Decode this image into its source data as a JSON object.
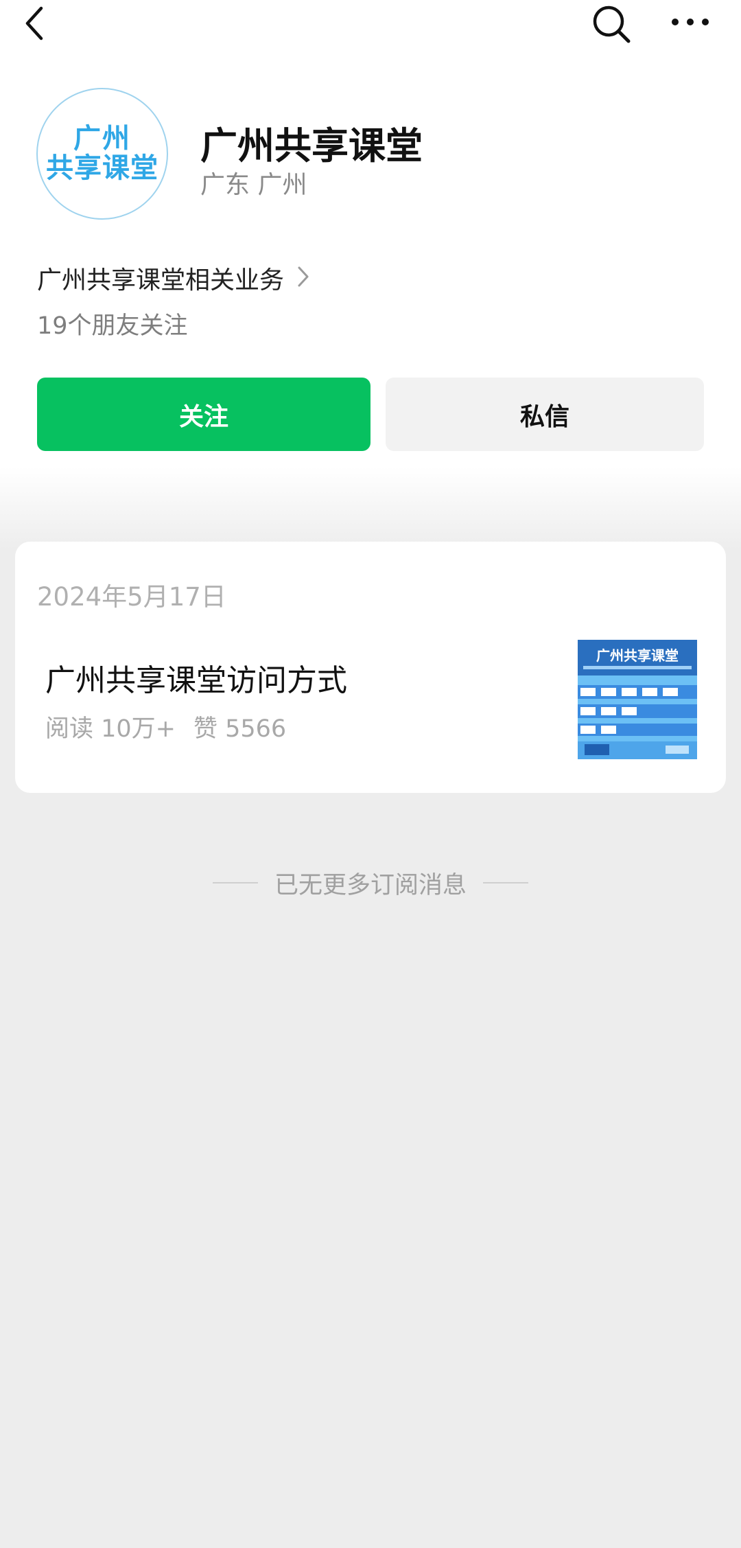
{
  "topbar": {
    "back_icon": "back-chevron-icon",
    "search_icon": "search-icon",
    "more_icon": "more-dots-icon"
  },
  "account": {
    "avatar_line1": "广州",
    "avatar_line2": "共享课堂",
    "name": "广州共享课堂",
    "region": "广东 广州",
    "business": "广州共享课堂相关业务",
    "friends_following": "19个朋友关注"
  },
  "actions": {
    "follow_label": "关注",
    "message_label": "私信"
  },
  "articles": [
    {
      "date": "2024年5月17日",
      "title": "广州共享课堂访问方式",
      "reads": "阅读 10万+",
      "likes": "赞 5566",
      "thumbnail_title": "广州共享课堂"
    }
  ],
  "footer": {
    "end_text": "已无更多订阅消息"
  },
  "colors": {
    "accent_green": "#07c160",
    "avatar_blue": "#2fa7e6",
    "page_bg": "#ededed"
  }
}
